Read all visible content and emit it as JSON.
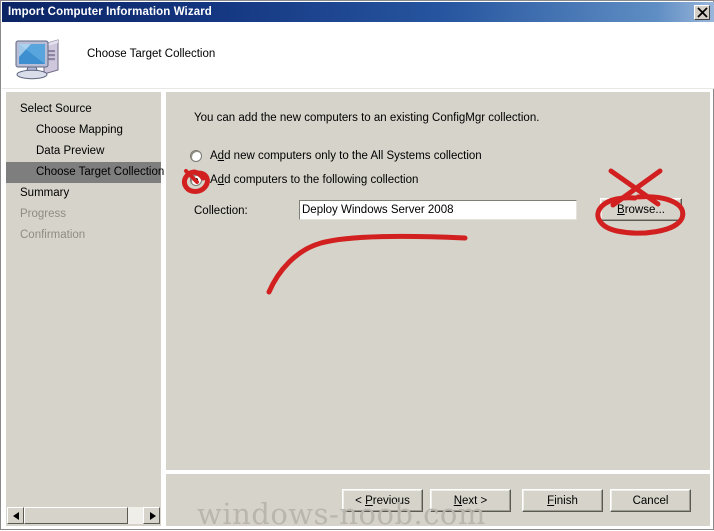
{
  "window": {
    "title": "Import Computer Information Wizard",
    "close_icon": "close-x-icon"
  },
  "header": {
    "title": "Choose Target Collection",
    "icon": "computer-icon"
  },
  "sidebar": {
    "items": [
      {
        "label": "Select Source",
        "level": 0,
        "state": "done"
      },
      {
        "label": "Choose Mapping",
        "level": 1,
        "state": "done"
      },
      {
        "label": "Data Preview",
        "level": 1,
        "state": "done"
      },
      {
        "label": "Choose Target Collection",
        "level": 1,
        "state": "current"
      },
      {
        "label": "Summary",
        "level": 0,
        "state": "done"
      },
      {
        "label": "Progress",
        "level": 0,
        "state": "disabled"
      },
      {
        "label": "Confirmation",
        "level": 0,
        "state": "disabled"
      }
    ]
  },
  "main": {
    "intro": "You can add the new computers to an existing ConfigMgr collection.",
    "radio_options": [
      {
        "label_pre": "A",
        "label_accel": "d",
        "label_post": "d new computers only to the All Systems collection",
        "selected": false
      },
      {
        "label_pre": "A",
        "label_accel": "d",
        "label_post": "d computers to the following collection",
        "selected": true
      }
    ],
    "collection_label": "Collection:",
    "collection_value": "Deploy Windows Server 2008",
    "collection_placeholder": "",
    "browse_pre": "",
    "browse_accel": "B",
    "browse_post": "rowse..."
  },
  "footer": {
    "buttons": [
      {
        "pre": "< ",
        "accel": "P",
        "post": "revious"
      },
      {
        "pre": "",
        "accel": "N",
        "post": "ext >"
      },
      {
        "pre": "",
        "accel": "F",
        "post": "inish"
      },
      {
        "pre": "Cancel",
        "accel": "",
        "post": ""
      }
    ]
  },
  "scrollbar": {
    "left_arrow_icon": "triangle-left-icon",
    "right_arrow_icon": "triangle-right-icon"
  },
  "watermark": {
    "text": "windows-noob.com"
  },
  "annotations": {
    "color": "#d22020",
    "marks": [
      {
        "name": "circle-around-selected-radio",
        "shape": "ellipse"
      },
      {
        "name": "cross-over-browse-button",
        "shape": "x"
      },
      {
        "name": "ellipse-around-browse-button",
        "shape": "ellipse"
      },
      {
        "name": "curved-underline-pointer",
        "shape": "curve"
      }
    ]
  }
}
